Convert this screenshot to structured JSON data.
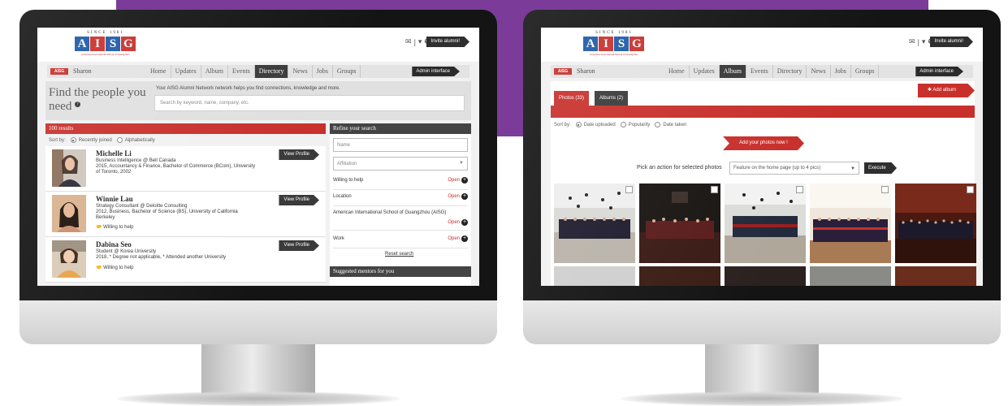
{
  "colors": {
    "brand_purple": "#7a3c98",
    "brand_red": "#c8302c",
    "dark": "#3a3a3a",
    "logo_blue": "#1d5aa8"
  },
  "header": {
    "logo": {
      "since": "SINCE 1981",
      "letters": [
        "A",
        "I",
        "S",
        "G"
      ],
      "subtitle": "American International School of Guangzhou"
    },
    "icons": [
      "mail-icon",
      "divider",
      "dropdown-icon",
      "settings-icon"
    ],
    "invite_label": "Invite alumni!"
  },
  "nav": {
    "flag_label": "AISG",
    "user": "Sharon",
    "items": [
      "Home",
      "Updates",
      "Album",
      "Events",
      "Directory",
      "News",
      "Jobs",
      "Groups"
    ],
    "admin_label": "Admin interface"
  },
  "directory": {
    "title": "Find the people you need",
    "description": "Your AISG Alumni Network network helps you find connections, knowledge and more.",
    "search_placeholder": "Search by keyword, name, company, etc.",
    "results_count": "100 results",
    "sort_label": "Sort by:",
    "sort_options": [
      {
        "label": "Recently joined",
        "selected": true
      },
      {
        "label": "Alphabetically",
        "selected": false
      }
    ],
    "view_profile_label": "View Profile",
    "willing_label": "Willing to help",
    "results": [
      {
        "name": "Michelle Li",
        "lines": [
          "Business Intelligence @ Bell Canada",
          "2015, Accountancy & Finance, Bachelor of Commerce (BCom), University",
          "of Toronto, 2002"
        ],
        "willing": false
      },
      {
        "name": "Winnie Lau",
        "lines": [
          "Strategy Consultant @ Deloitte Consulting",
          "2012, Business, Bachelor of Science (BS), University of California",
          "Berkeley"
        ],
        "willing": true
      },
      {
        "name": "Dabina Seo",
        "lines": [
          "Student @ Korea University",
          "2018, * Degree not applicable, * Attended another University"
        ],
        "willing": true
      }
    ],
    "refine": {
      "title": "Refine your search",
      "name_placeholder": "Name",
      "affiliation_placeholder": "Affiliation",
      "filters": [
        {
          "label": "Willing to help",
          "action": "Open"
        },
        {
          "label": "Location",
          "action": "Open"
        },
        {
          "label": "American International School of Guangzhou (AISG)",
          "action": "Open"
        },
        {
          "label": "Work",
          "action": "Open"
        }
      ],
      "reset_label": "Reset search",
      "mentors_title": "Suggested mentors for you"
    }
  },
  "album": {
    "tabs": [
      {
        "label": "Photos (33)",
        "active": true
      },
      {
        "label": "Albums (2)",
        "active": false
      }
    ],
    "add_album_label": "Add album",
    "sort_label": "Sort by:",
    "sort_options": [
      {
        "label": "Date uploaded",
        "selected": true
      },
      {
        "label": "Popularity",
        "selected": false
      },
      {
        "label": "Date taken",
        "selected": false
      }
    ],
    "add_photos_label": "Add your photos now !",
    "action_label": "Pick an action for selected photos",
    "action_select_value": "Feature on the home page (up to 4 pics)",
    "execute_label": "Execute",
    "photos": [
      {
        "scene": "graduation-caps-thrown-stage"
      },
      {
        "scene": "graduation-dark-auditorium"
      },
      {
        "scene": "graduation-group-caps-thrown"
      },
      {
        "scene": "graduation-group-portrait-bright"
      },
      {
        "scene": "graduation-auditorium-seated"
      }
    ]
  }
}
